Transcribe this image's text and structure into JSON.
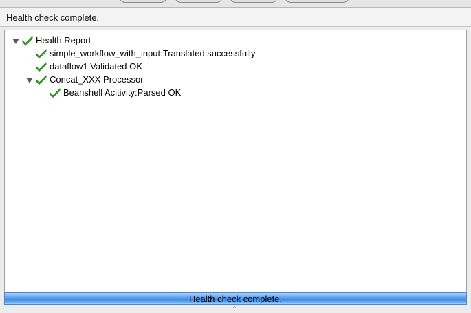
{
  "status_top": {
    "text": "Health check complete."
  },
  "tree": {
    "items": [
      {
        "label": "Health Report",
        "expanded": true
      },
      {
        "label": "simple_workflow_with_input:Translated successfully"
      },
      {
        "label": "dataflow1:Validated OK"
      },
      {
        "label": "Concat_XXX Processor",
        "expanded": true
      },
      {
        "label": "Beanshell Acitivity:Parsed OK"
      }
    ]
  },
  "progress": {
    "text": "Health check complete.",
    "value": 1.0
  },
  "icons": {
    "item": "green-check-icon",
    "toggle": "disclosure-triangle-icon",
    "grip": "resize-grip-icon"
  },
  "colors": {
    "check": "#3aa82a",
    "progress": "#3d89e6"
  }
}
